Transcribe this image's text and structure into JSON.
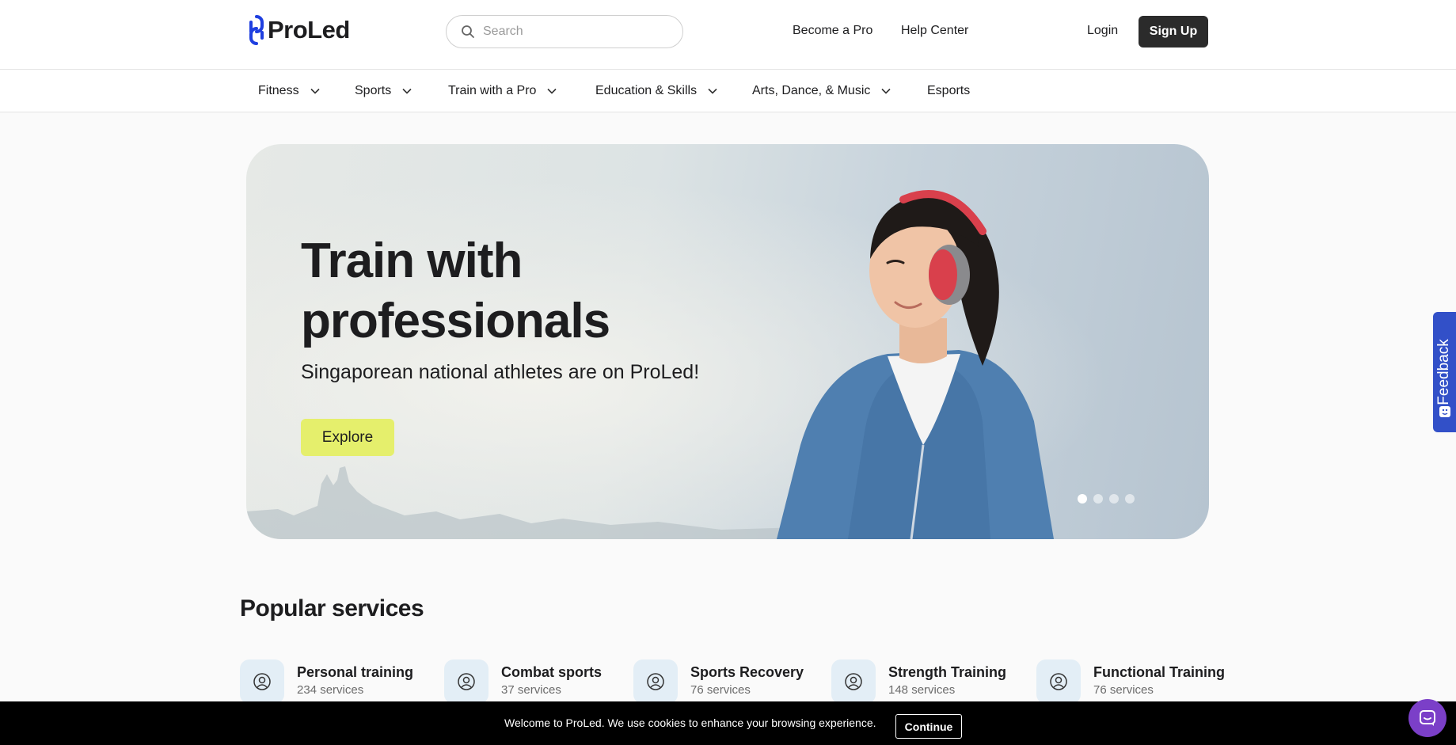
{
  "header": {
    "logo_text": "ProLed",
    "search_placeholder": "Search",
    "links": [
      "Become a Pro",
      "Help Center"
    ],
    "login_label": "Login",
    "signup_label": "Sign Up"
  },
  "categories": [
    {
      "label": "Fitness",
      "has_dropdown": true
    },
    {
      "label": "Sports",
      "has_dropdown": true
    },
    {
      "label": "Train with a Pro",
      "has_dropdown": true
    },
    {
      "label": "Education & Skills",
      "has_dropdown": true
    },
    {
      "label": "Arts, Dance, & Music",
      "has_dropdown": true
    },
    {
      "label": "Esports",
      "has_dropdown": false
    }
  ],
  "hero": {
    "title_line1": "Train with",
    "title_line2": "professionals",
    "subtitle": "Singaporean national athletes are on ProLed!",
    "cta_label": "Explore",
    "slides_total": 4,
    "active_slide": 1
  },
  "popular": {
    "title": "Popular services",
    "services": [
      {
        "name": "Personal training",
        "count": "234 services",
        "icon": "user-circle-icon"
      },
      {
        "name": "Combat sports",
        "count": "37 services",
        "icon": "user-circle-icon"
      },
      {
        "name": "Sports Recovery",
        "count": "76 services",
        "icon": "user-circle-icon"
      },
      {
        "name": "Strength Training",
        "count": "148 services",
        "icon": "user-circle-icon"
      },
      {
        "name": "Functional Training",
        "count": "76 services",
        "icon": "user-circle-icon"
      }
    ]
  },
  "feedback": {
    "label": "Feedback"
  },
  "cookie": {
    "text": "Welcome to ProLed. We use cookies to enhance your browsing experience.",
    "button_label": "Continue"
  },
  "colors": {
    "brand_blue": "#1f3fe0",
    "cta_yellow": "#e5ef6c",
    "feedback_blue": "#3250c8",
    "chat_purple": "#7b3fc8"
  }
}
